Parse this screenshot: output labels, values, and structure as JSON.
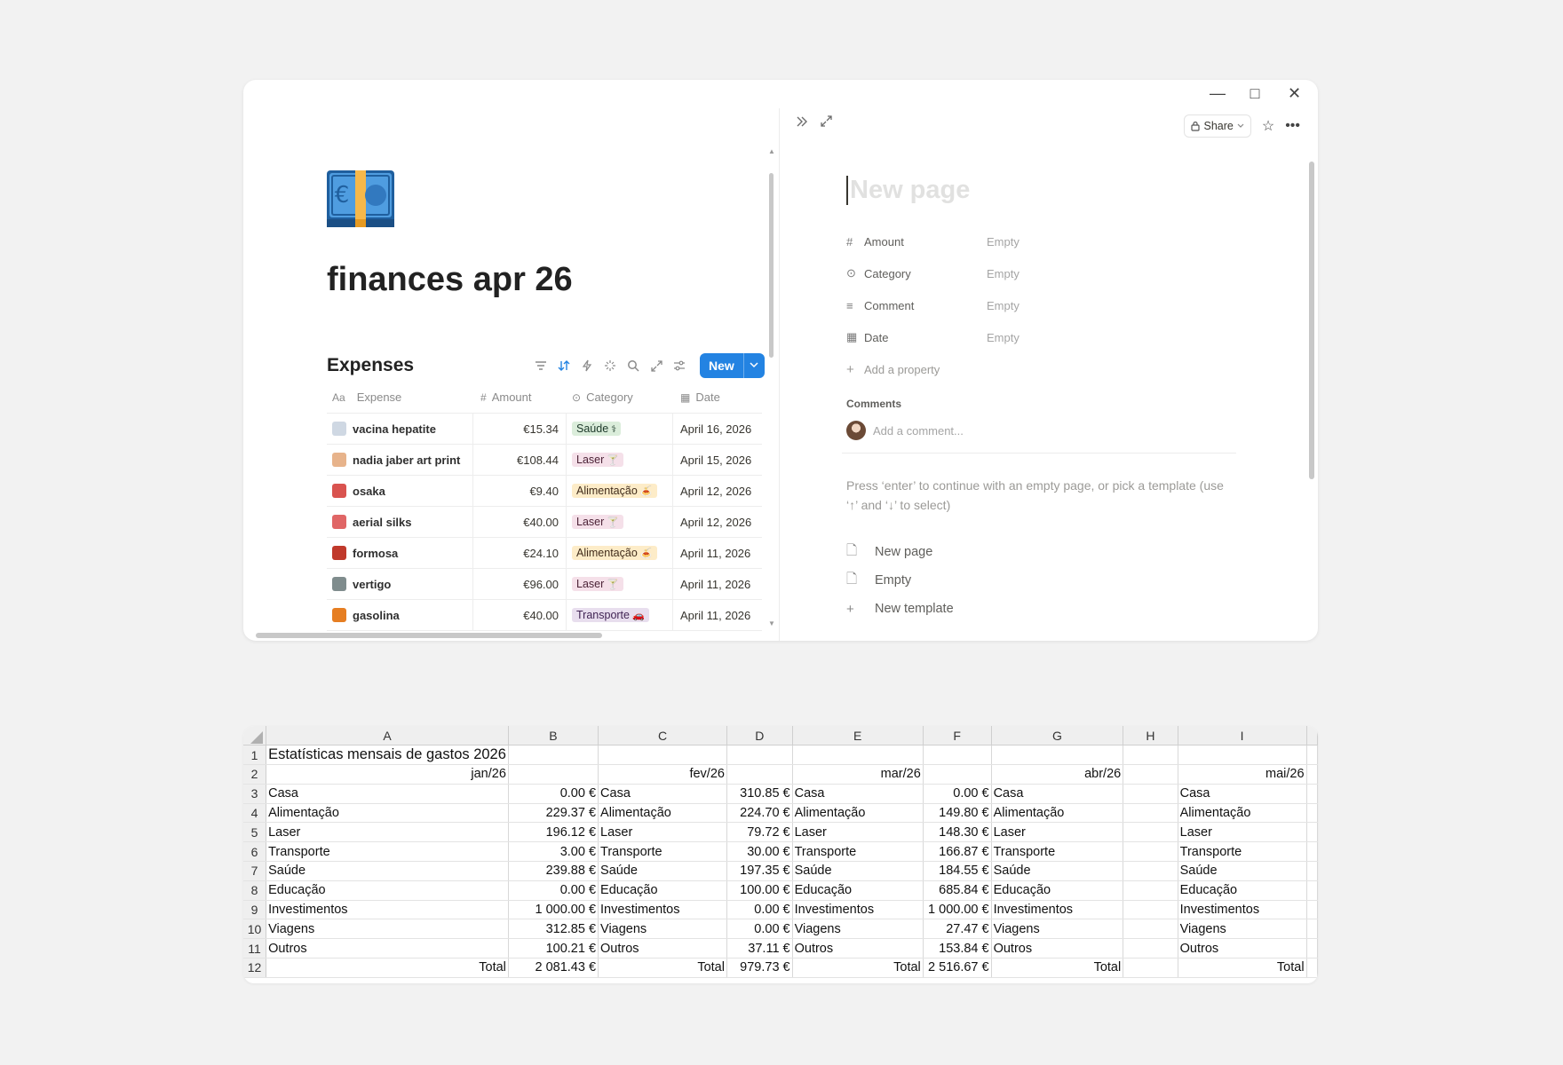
{
  "window_controls": [
    "—",
    "□",
    "✕"
  ],
  "page": {
    "title": "finances apr 26",
    "icon": "euro-banknote-icon"
  },
  "database": {
    "title": "Expenses",
    "new_label": "New",
    "columns": [
      {
        "icon": "Aa",
        "label": "Expense"
      },
      {
        "icon": "#",
        "label": "Amount"
      },
      {
        "icon": "⊙",
        "label": "Category"
      },
      {
        "icon": "▦",
        "label": "Date"
      }
    ],
    "rows": [
      {
        "emoji": "💉",
        "color": "#cfd8e3",
        "expense": "vacina hepatite",
        "amount": "€15.34",
        "category": "Saúde",
        "cat_class": "saude",
        "cat_emoji": "⚕",
        "date": "April 16, 2026"
      },
      {
        "emoji": "🎨",
        "color": "#e7b38b",
        "expense": "nadia jaber art print",
        "amount": "€108.44",
        "category": "Laser",
        "cat_class": "laser",
        "cat_emoji": "🍸",
        "date": "April 15, 2026"
      },
      {
        "emoji": "🍣",
        "color": "#d9534f",
        "expense": "osaka",
        "amount": "€9.40",
        "category": "Alimentação",
        "cat_class": "alimentacao",
        "cat_emoji": "🍝",
        "date": "April 12, 2026"
      },
      {
        "emoji": "🎪",
        "color": "#e06666",
        "expense": "aerial silks",
        "amount": "€40.00",
        "category": "Laser",
        "cat_class": "laser",
        "cat_emoji": "🍸",
        "date": "April 12, 2026"
      },
      {
        "emoji": "🇹🇼",
        "color": "#c0392b",
        "expense": "formosa",
        "amount": "€24.10",
        "category": "Alimentação",
        "cat_class": "alimentacao",
        "cat_emoji": "🍝",
        "date": "April 11, 2026"
      },
      {
        "emoji": "🧗",
        "color": "#7f8c8d",
        "expense": "vertigo",
        "amount": "€96.00",
        "category": "Laser",
        "cat_class": "laser",
        "cat_emoji": "🍸",
        "date": "April 11, 2026"
      },
      {
        "emoji": "⛽",
        "color": "#e67e22",
        "expense": "gasolina",
        "amount": "€40.00",
        "category": "Transporte",
        "cat_class": "transporte",
        "cat_emoji": "🚗",
        "date": "April 11, 2026"
      }
    ]
  },
  "side_peek": {
    "share_label": "Share",
    "title_placeholder": "New page",
    "properties": [
      {
        "icon": "#",
        "name": "Amount",
        "value": "Empty"
      },
      {
        "icon": "⊙",
        "name": "Category",
        "value": "Empty"
      },
      {
        "icon": "≡",
        "name": "Comment",
        "value": "Empty"
      },
      {
        "icon": "▦",
        "name": "Date",
        "value": "Empty"
      }
    ],
    "add_property": "Add a property",
    "comments_label": "Comments",
    "comment_placeholder": "Add a comment...",
    "hint": "Press ‘enter’ to continue with an empty page, or pick a template (use ‘↑’ and ‘↓’ to select)",
    "templates": [
      {
        "icon": "🗋",
        "label": "New page"
      },
      {
        "icon": "🗋",
        "label": "Empty"
      },
      {
        "icon": "+",
        "label": "New template"
      }
    ]
  },
  "spreadsheet": {
    "columns": [
      "A",
      "B",
      "C",
      "D",
      "E",
      "F",
      "G",
      "H",
      "I"
    ],
    "title": "Estatísticas mensais de gastos 2026",
    "months": [
      "jan/26",
      "fev/26",
      "mar/26",
      "abr/26",
      "mai/26"
    ],
    "categories": [
      "Casa",
      "Alimentação",
      "Laser",
      "Transporte",
      "Saúde",
      "Educação",
      "Investimentos",
      "Viagens",
      "Outros"
    ],
    "total_label": "Total",
    "jan": [
      "0.00 €",
      "229.37 €",
      "196.12 €",
      "3.00 €",
      "239.88 €",
      "0.00 €",
      "1 000.00 €",
      "312.85 €",
      "100.21 €"
    ],
    "jan_total": "2 081.43 €",
    "fev": [
      "310.85 €",
      "224.70 €",
      "79.72 €",
      "30.00 €",
      "197.35 €",
      "100.00 €",
      "0.00 €",
      "0.00 €",
      "37.11 €"
    ],
    "fev_total": "979.73 €",
    "mar": [
      "0.00 €",
      "149.80 €",
      "148.30 €",
      "166.87 €",
      "184.55 €",
      "685.84 €",
      "1 000.00 €",
      "27.47 €",
      "153.84 €"
    ],
    "mar_total": "2 516.67 €"
  }
}
